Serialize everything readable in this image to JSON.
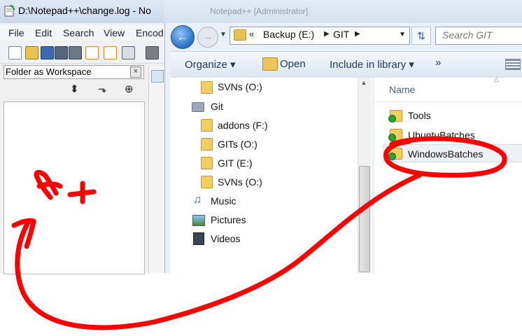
{
  "notepad": {
    "title": "D:\\Notepad++\\change.log - No",
    "menu": [
      "File",
      "Edit",
      "Search",
      "View",
      "Encod"
    ],
    "panel": {
      "title": "Folder as Workspace",
      "close_glyph": "×",
      "tools": [
        "⬍",
        "⬎",
        "⊕"
      ]
    }
  },
  "explorer": {
    "faded_title": "Notepad++ [Administrator]",
    "address": {
      "chevrons": "«",
      "drive": "Backup (E:)",
      "folder": "GIT"
    },
    "search_placeholder": "Search GIT",
    "commands": {
      "organize": "Organize ▾",
      "open": "Open",
      "include": "Include in library ▾",
      "more": "»"
    },
    "nav": {
      "svns_o_top": "SVNs (O:)",
      "git": "Git",
      "addons": "addons (F:)",
      "gits": "GITs (O:)",
      "git_e": "GIT (E:)",
      "svns_o": "SVNs (O:)",
      "music": "Music",
      "pictures": "Pictures",
      "videos": "Videos"
    },
    "column_header": "Name",
    "files": [
      "Tools",
      "UbuntuBatches",
      "WindowsBatches"
    ]
  },
  "annotation": {
    "color": "#ff0000",
    "description_glyph": "4+"
  }
}
